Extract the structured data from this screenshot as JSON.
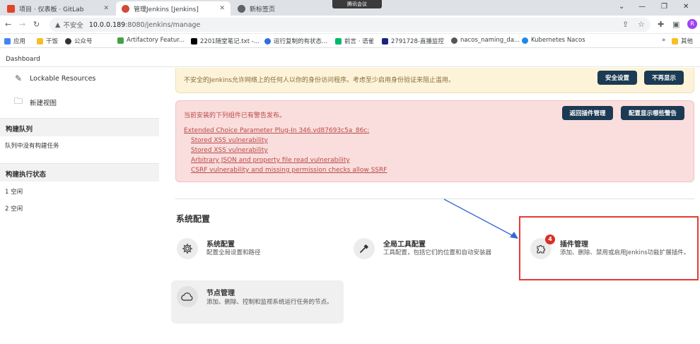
{
  "browser": {
    "tabs": [
      {
        "title": "项目 · 仪表板 · GitLab"
      },
      {
        "title": "管理Jenkins [Jenkins]"
      },
      {
        "title": "新标签页"
      }
    ],
    "meeting_label": "腾讯会议",
    "insecure_label": "不安全",
    "url_host": "10.0.0.189",
    "url_rest": ":8080/jenkins/manage",
    "profile_initial": "R",
    "bookmarks": [
      {
        "label": "应用",
        "color": "#4285f4"
      },
      {
        "label": "干饭",
        "color": "#f6bf26"
      },
      {
        "label": "公众号",
        "color": "#333333"
      },
      {
        "label": "Artifactory Featur...",
        "color": "#43a047"
      },
      {
        "label": "2201随堂笔记.txt -...",
        "color": "#000000"
      },
      {
        "label": "运行复制的有状态...",
        "color": "#326ce5"
      },
      {
        "label": "前言 · 语雀",
        "color": "#00b96b"
      },
      {
        "label": "2791728-直播监控",
        "color": "#1a237e"
      },
      {
        "label": "nacos_naming_da...",
        "color": "#555555"
      },
      {
        "label": "Kubernetes Nacos",
        "color": "#1e88e5"
      },
      {
        "label": "其他",
        "color": "#f6bf26"
      }
    ]
  },
  "breadcrumb": {
    "label": "Dashboard"
  },
  "sidebar": {
    "links": [
      {
        "label": "Lockable Resources",
        "icon": "lock-resources-icon"
      },
      {
        "label": "新建视图",
        "icon": "folder-icon"
      }
    ],
    "build_queue": {
      "title": "构建队列",
      "empty_text": "队列中没有构建任务"
    },
    "executors": {
      "title": "构建执行状态",
      "items": [
        {
          "num": "1",
          "state": "空闲"
        },
        {
          "num": "2",
          "state": "空闲"
        }
      ]
    }
  },
  "alerts": {
    "security": {
      "message": "不安全的Jenkins允许网络上的任何人以你的身份访问程序。考虑至少启用身份验证来阻止滥用。",
      "btn_setup": "安全设置",
      "btn_dismiss": "不再显示"
    },
    "plugins": {
      "message": "当前安装的下列组件已有警告发布。",
      "btn_manage": "返回插件管理",
      "btn_configure": "配置显示哪些警告",
      "plugin_name": "Extended Choice Parameter Plug-In 346.vd87693c5a_86c",
      "plugin_tail": ":",
      "vulnerabilities": [
        "Stored XSS vulnerability",
        "Stored XSS vulnerability",
        "Arbitrary JSON and property file read vulnerability",
        "CSRF vulnerability and missing permission checks allow SSRF"
      ]
    }
  },
  "system_config": {
    "section_title": "系统配置",
    "cards": [
      {
        "title": "系统配置",
        "desc": "配置全局设置和路径",
        "icon": "gear-icon"
      },
      {
        "title": "全局工具配置",
        "desc": "工具配置，包括它们的位置和自动安装器",
        "icon": "hammer-icon"
      },
      {
        "title": "插件管理",
        "desc": "添加、删除、禁用或启用Jenkins功能扩展插件。",
        "icon": "puzzle-icon",
        "badge": "4"
      },
      {
        "title": "节点管理",
        "desc": "添加、删除、控制和监视系统运行任务的节点。",
        "icon": "cloud-icon"
      }
    ]
  },
  "colors": {
    "accent_dark": "#1b3a53",
    "danger": "#b94a48",
    "highlight": "#e53935",
    "arrow": "#3367d6"
  }
}
